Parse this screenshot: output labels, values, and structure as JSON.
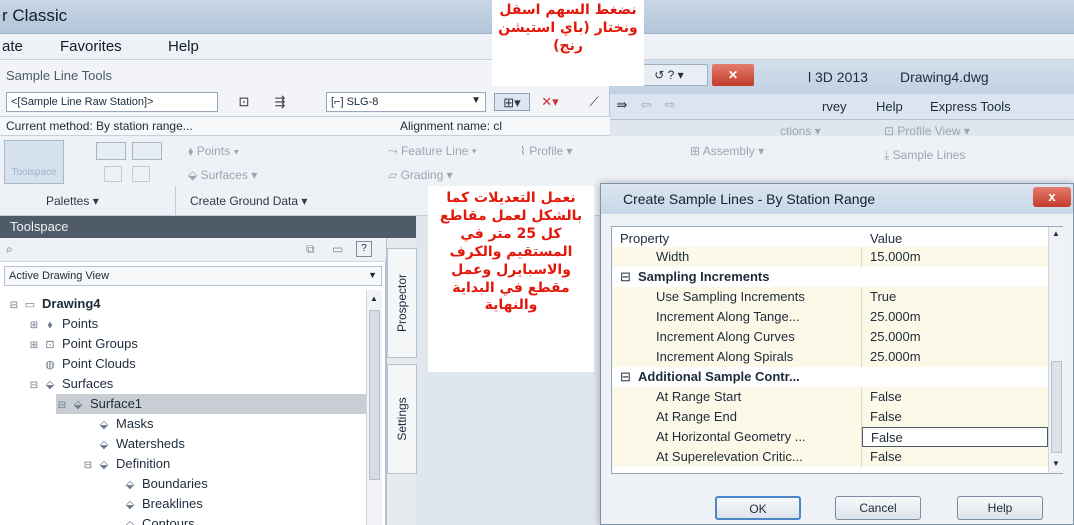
{
  "window": {
    "title": "r Classic",
    "civil_title_fragment": "l 3D 2013",
    "drawing_name": "Drawing4.dwg"
  },
  "menu": [
    "ate",
    "Favorites",
    "Help"
  ],
  "civil_menu": [
    "rvey",
    "Help",
    "Express Tools"
  ],
  "sample_line_tools": {
    "title": "Sample Line Tools",
    "station_combo": "<[Sample Line Raw Station]>",
    "group_combo": "[⌐] SLG-8",
    "current_method": "Current method: By station range...",
    "alignment": "Alignment name: cl"
  },
  "ribbon": {
    "toolspace_btn": "Toolspace",
    "points": "Points",
    "surfaces": "Surfaces",
    "feature_line": "Feature Line",
    "profile": "Profile",
    "grading": "Grading",
    "assembly": "Assembly",
    "profile_view": "Profile View",
    "sample_lines": "Sample Lines",
    "sections": "ctions",
    "palettes_label": "Palettes",
    "create_ground_label": "Create Ground Data"
  },
  "toolspace": {
    "title": "Toolspace",
    "view_combo": "Active Drawing View",
    "tree": [
      {
        "label": "Drawing4",
        "bold": true,
        "level": 0
      },
      {
        "label": "Points",
        "level": 1
      },
      {
        "label": "Point Groups",
        "level": 1
      },
      {
        "label": "Point Clouds",
        "level": 1
      },
      {
        "label": "Surfaces",
        "level": 1
      },
      {
        "label": "Surface1",
        "level": 2,
        "selected": true
      },
      {
        "label": "Masks",
        "level": 3
      },
      {
        "label": "Watersheds",
        "level": 3
      },
      {
        "label": "Definition",
        "level": 3
      },
      {
        "label": "Boundaries",
        "level": 4
      },
      {
        "label": "Breaklines",
        "level": 4
      },
      {
        "label": "Contours",
        "level": 4
      }
    ],
    "side_tabs": [
      "Prospector",
      "Settings"
    ]
  },
  "dialog": {
    "title": "Create Sample Lines - By Station Range",
    "close_label": "x",
    "header_property": "Property",
    "header_value": "Value",
    "rows": [
      {
        "name": "Width",
        "value": "15.000m"
      },
      {
        "name": "Sampling Increments",
        "value": "",
        "category": true
      },
      {
        "name": "Use Sampling Increments",
        "value": "True"
      },
      {
        "name": "Increment Along Tange...",
        "value": "25.000m"
      },
      {
        "name": "Increment Along Curves",
        "value": "25.000m"
      },
      {
        "name": "Increment Along Spirals",
        "value": "25.000m"
      },
      {
        "name": "Additional Sample Contr...",
        "value": "",
        "category": true
      },
      {
        "name": "At Range Start",
        "value": "False"
      },
      {
        "name": "At Range End",
        "value": "False"
      },
      {
        "name": "At Horizontal Geometry ...",
        "value": "False"
      },
      {
        "name": "At Superelevation Critic...",
        "value": "False"
      }
    ],
    "ok": "OK",
    "cancel": "Cancel",
    "help": "Help"
  },
  "annotations": {
    "top": "نضغط السهم اسفل ونختار (باي استيشن رنج)",
    "middle": "نعمل التعديلات كما بالشكل لعمل مقاطع كل 25 متر في المستقيم والكرف والاسبايرل وعمل مقطع في البداية والنهاية"
  },
  "colors": {
    "annotation_red": "#e3170a",
    "row_cream": "#fdf9e9",
    "selected_gray": "#c9ced4"
  }
}
